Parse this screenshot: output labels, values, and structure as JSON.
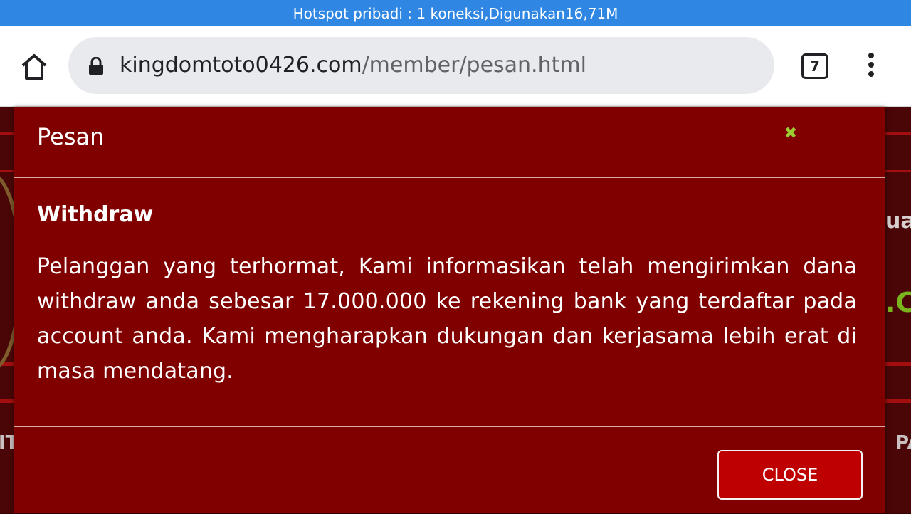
{
  "status_bar": {
    "text": "Hotspot pribadi : 1 koneksi,Digunakan16,71M"
  },
  "browser": {
    "url_domain": "kingdomtoto0426.com",
    "url_path": "/member/pesan.html",
    "tab_count": "7",
    "icons": [
      "home-icon",
      "lock-icon",
      "tabs-icon",
      "more-vert-icon"
    ]
  },
  "background": {
    "right_text_1": "uar",
    "right_text_2": ".C",
    "left_text": "IT",
    "right_text_3": "PA"
  },
  "modal": {
    "title": "Pesan",
    "close_x_icon": "close-icon",
    "subject": "Withdraw",
    "message": "Pelanggan yang terhormat, Kami informasikan telah mengirimkan dana withdraw anda sebesar 17.000.000 ke rekening bank yang terdaftar pada account anda. Kami mengharapkan dukungan dan kerjasama lebih erat di masa mendatang.",
    "close_button_label": "CLOSE"
  },
  "colors": {
    "status_bar": "#2f86e3",
    "modal_bg": "#800000",
    "close_button": "#bf0000",
    "close_x": "#9acd32"
  }
}
